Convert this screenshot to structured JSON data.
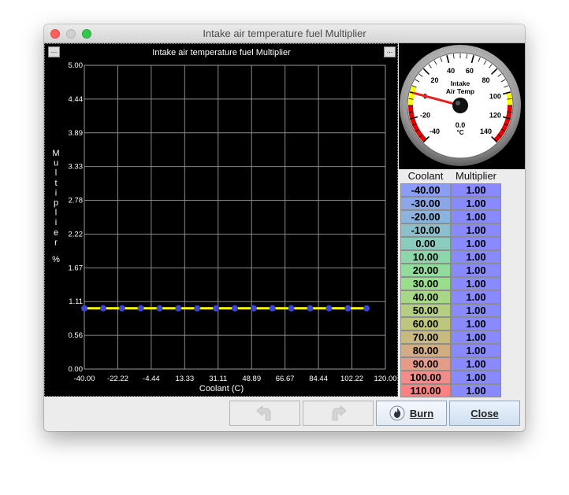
{
  "window": {
    "title": "Intake air temperature fuel Multiplier"
  },
  "chart_data": {
    "type": "line",
    "title": "Intake air temperature fuel Multiplier",
    "xlabel": "Coolant (C)",
    "ylabel": "Multiplier",
    "yunit": "%",
    "xlim": [
      -40,
      120
    ],
    "ylim": [
      0,
      5
    ],
    "x_ticks": [
      "-40.00",
      "-22.22",
      "-4.44",
      "13.33",
      "31.11",
      "48.89",
      "66.67",
      "84.44",
      "102.22",
      "120.00"
    ],
    "y_ticks": [
      "5.00",
      "4.44",
      "3.89",
      "3.33",
      "2.78",
      "2.22",
      "1.67",
      "1.11",
      "0.56",
      "0.00"
    ],
    "series": [
      {
        "x": [
          -40,
          -30,
          -20,
          -10,
          0,
          10,
          20,
          30,
          40,
          50,
          60,
          70,
          80,
          90,
          100,
          110
        ],
        "values": [
          1,
          1,
          1,
          1,
          1,
          1,
          1,
          1,
          1,
          1,
          1,
          1,
          1,
          1,
          1,
          1
        ],
        "color": "#ffff00",
        "point_color": "#3c46d2"
      }
    ],
    "grid": true,
    "background": "#000000"
  },
  "gauge": {
    "title_line1": "Intake",
    "title_line2": "Air Temp",
    "value_text": "0.0",
    "unit": "°C",
    "value": 0.0,
    "min": -40,
    "max": 140,
    "tick_labels": [
      "-40",
      "-20",
      "0",
      "20",
      "40",
      "60",
      "80",
      "100",
      "120",
      "140"
    ]
  },
  "table": {
    "col1_header": "Coolant",
    "col2_header": "Multiplier",
    "rows": [
      {
        "c": "-40.00",
        "m": "1.00",
        "color": "#8a9ef5"
      },
      {
        "c": "-30.00",
        "m": "1.00",
        "color": "#8aa8e8"
      },
      {
        "c": "-20.00",
        "m": "1.00",
        "color": "#8ab4db"
      },
      {
        "c": "-10.00",
        "m": "1.00",
        "color": "#8ac0cd"
      },
      {
        "c": "0.00",
        "m": "1.00",
        "color": "#8accbd"
      },
      {
        "c": "10.00",
        "m": "1.00",
        "color": "#8cd6ac"
      },
      {
        "c": "20.00",
        "m": "1.00",
        "color": "#90dc9a"
      },
      {
        "c": "30.00",
        "m": "1.00",
        "color": "#98de8c"
      },
      {
        "c": "40.00",
        "m": "1.00",
        "color": "#a6d886"
      },
      {
        "c": "50.00",
        "m": "1.00",
        "color": "#b2d080"
      },
      {
        "c": "60.00",
        "m": "1.00",
        "color": "#bec67c"
      },
      {
        "c": "70.00",
        "m": "1.00",
        "color": "#c8ba7e"
      },
      {
        "c": "80.00",
        "m": "1.00",
        "color": "#d4ac84"
      },
      {
        "c": "90.00",
        "m": "1.00",
        "color": "#e49c88"
      },
      {
        "c": "100.00",
        "m": "1.00",
        "color": "#f08c8a"
      },
      {
        "c": "110.00",
        "m": "1.00",
        "color": "#fc8282"
      }
    ]
  },
  "buttons": {
    "undo_icon": "undo-arrow-icon",
    "redo_icon": "redo-arrow-icon",
    "burn_label": "Burn",
    "burn_icon": "flame-icon",
    "close_label": "Close"
  },
  "menu_glyph": "..."
}
